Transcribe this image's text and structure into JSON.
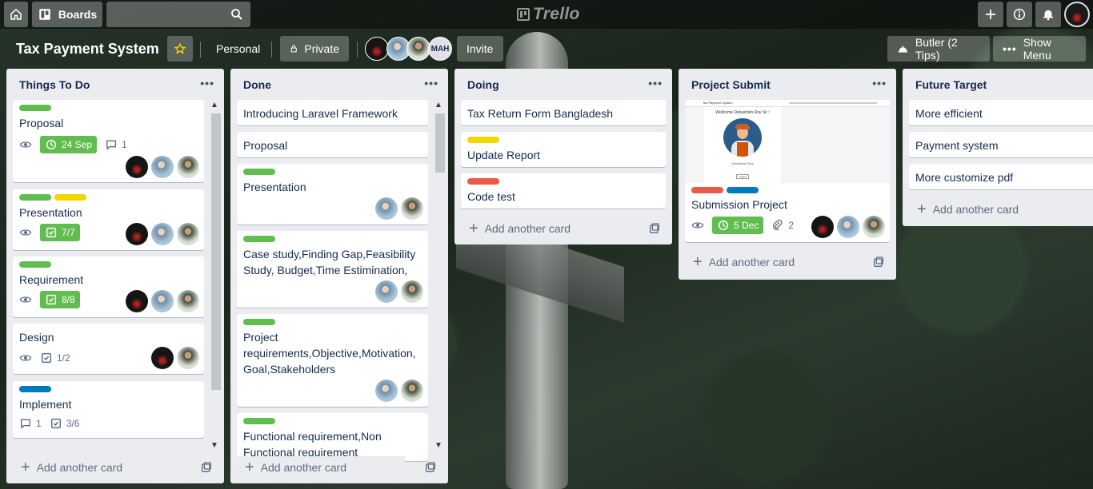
{
  "header": {
    "boards_label": "Boards",
    "logo_text": "Trello"
  },
  "board": {
    "title": "Tax Payment System",
    "team": "Personal",
    "visibility": "Private",
    "member_initials": "MAH",
    "invite": "Invite",
    "butler": "Butler (2 Tips)",
    "show_menu": "Show Menu"
  },
  "add_card_label": "Add another card",
  "lists": [
    {
      "title": "Things To Do",
      "cards": [
        {
          "title": "Proposal",
          "due": "24 Sep",
          "comments": "1"
        },
        {
          "title": "Presentation",
          "checklist": "7/7"
        },
        {
          "title": "Requirement",
          "checklist": "8/8"
        },
        {
          "title": "Design",
          "checklist": "1/2"
        },
        {
          "title": "Implement",
          "comments": "1",
          "checklist": "3/6"
        }
      ]
    },
    {
      "title": "Done",
      "cards": [
        {
          "title": "Introducing Laravel Framework"
        },
        {
          "title": "Proposal"
        },
        {
          "title": "Presentation"
        },
        {
          "title": "Case study,Finding Gap,Feasibility Study, Budget,Time Estimination,"
        },
        {
          "title": "Project requirements,Objective,Motivation, Goal,Stakeholders"
        },
        {
          "title": "Functional requirement,Non Functional requirement"
        }
      ]
    },
    {
      "title": "Doing",
      "cards": [
        {
          "title": "Tax Return Form Bangladesh"
        },
        {
          "title": "Update Report"
        },
        {
          "title": "Code test"
        }
      ]
    },
    {
      "title": "Project Submit",
      "cards": [
        {
          "title": "Submission Project",
          "due": "5 Dec",
          "attachments": "2",
          "cover": {
            "site_title": "Tax Payment System",
            "welcome": "Wellcome Debashish Roy Sir !",
            "name": "Debashish Roy",
            "button": "Logout"
          }
        }
      ]
    },
    {
      "title": "Future Target",
      "cards": [
        {
          "title": "More efficient"
        },
        {
          "title": "Payment system"
        },
        {
          "title": "More customize pdf"
        }
      ]
    }
  ],
  "colors": {
    "green": "#61bd4f",
    "yellow": "#f2d600",
    "red": "#eb5a46",
    "blue": "#0079bf"
  }
}
